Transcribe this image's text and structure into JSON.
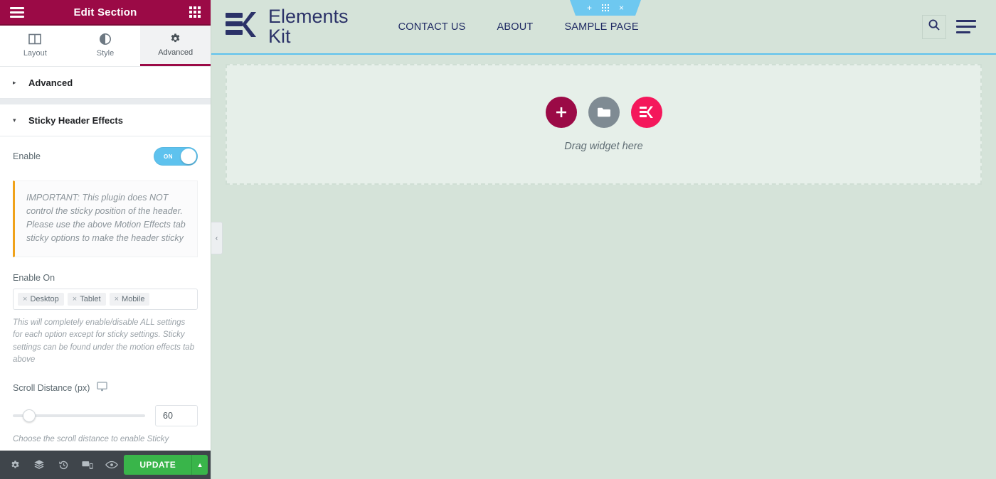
{
  "panel": {
    "header": {
      "title": "Edit Section",
      "menu_icon": "hamburger-icon",
      "grid_icon": "grid-apps-icon"
    },
    "tabs": [
      {
        "id": "layout",
        "label": "Layout",
        "icon": "columns-icon",
        "active": false
      },
      {
        "id": "style",
        "label": "Style",
        "icon": "contrast-circle-icon",
        "active": false
      },
      {
        "id": "advanced",
        "label": "Advanced",
        "icon": "gear-icon",
        "active": true
      }
    ],
    "sections": [
      {
        "id": "advanced",
        "title": "Advanced",
        "expanded": false,
        "caret": "▸"
      },
      {
        "id": "sticky-header-effects",
        "title": "Sticky Header Effects",
        "expanded": true,
        "caret": "▾"
      }
    ],
    "enable": {
      "label": "Enable",
      "value": "ON",
      "state": true
    },
    "notice": "IMPORTANT: This plugin does NOT control the sticky position of the header. Please use the above Motion Effects tab sticky options to make the header sticky",
    "enable_on": {
      "label": "Enable On",
      "tags": [
        {
          "label": "Desktop",
          "remove": "×"
        },
        {
          "label": "Tablet",
          "remove": "×"
        },
        {
          "label": "Mobile",
          "remove": "×"
        }
      ],
      "hint": "This will completely enable/disable ALL settings for each option except for sticky settings. Sticky settings can be found under the motion effects tab above"
    },
    "scroll_distance": {
      "label": "Scroll Distance (px)",
      "device_icon": "desktop-icon",
      "value": "60",
      "slider_percent": 10,
      "hint": "Choose the scroll distance to enable Sticky"
    },
    "footer": {
      "icons": [
        {
          "name": "settings-gear-icon"
        },
        {
          "name": "layers-navigator-icon"
        },
        {
          "name": "history-icon"
        },
        {
          "name": "responsive-mode-icon"
        },
        {
          "name": "preview-eye-icon"
        }
      ],
      "update_label": "UPDATE",
      "update_caret": "▲"
    },
    "collapse_handle": {
      "icon": "chevron-left-icon",
      "glyph": "‹"
    }
  },
  "canvas": {
    "section_toolbar": {
      "add_icon": "plus-icon",
      "drag_icon": "drag-dots-icon",
      "close_icon": "close-x-icon",
      "add_glyph": "+",
      "close_glyph": "×",
      "color": "#6ec8f0"
    },
    "site_header": {
      "logo": {
        "icon": "ek-logo-icon",
        "line1": "Elements",
        "line2": "Kit",
        "color": "#2b3268"
      },
      "nav": [
        {
          "label": "CONTACT US"
        },
        {
          "label": "ABOUT"
        },
        {
          "label": "SAMPLE PAGE"
        }
      ],
      "search_icon": "search-icon",
      "menu_icon": "hamburger-menu-icon",
      "border_color": "#5ec2ee",
      "background": "#d5e3d9"
    },
    "dropzone": {
      "buttons": [
        {
          "name": "add-widget-button",
          "icon": "plus-icon",
          "color": "#9b0a46"
        },
        {
          "name": "template-library-button",
          "icon": "folder-icon",
          "color": "#7f8b93"
        },
        {
          "name": "elementskit-widget-button",
          "icon": "ek-logo-icon",
          "color": "#f4175b"
        }
      ],
      "text": "Drag widget here"
    }
  }
}
